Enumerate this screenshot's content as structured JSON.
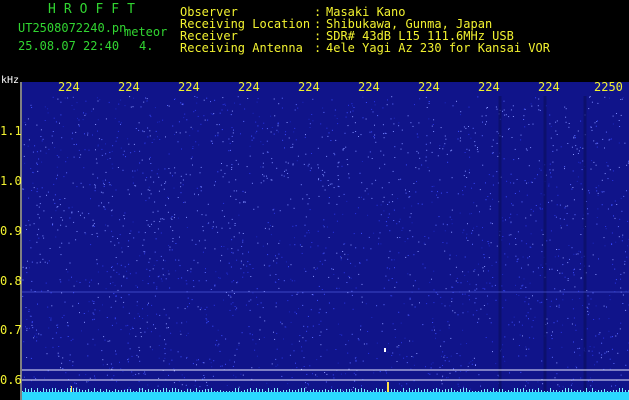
{
  "header": {
    "app_name": "HROFFT",
    "file_name": "UT2508072240.pn",
    "mode": "meteor",
    "date_time": "25.08.07 22:40",
    "counter": "4."
  },
  "info": {
    "observer_label": "Observer",
    "location_label": "Receiving Location",
    "receiver_label": "Receiver",
    "antenna_label": "Receiving Antenna",
    "colon": ":",
    "observer_value": "Masaki Kano",
    "location_value": "Shibukawa, Gunma, Japan",
    "receiver_value": "SDR# 43dB L15 111.6MHz USB",
    "antenna_value": "4ele Yagi Az 230 for Kansai VOR"
  },
  "axis": {
    "unit_label": "kHz",
    "time_ticks": [
      "224",
      "224",
      "224",
      "224",
      "224",
      "224",
      "224",
      "224",
      "224",
      "2250"
    ],
    "freq_ticks": [
      "1.1",
      "1.0",
      "0.9",
      "0.8",
      "0.7",
      "0.6"
    ]
  },
  "colors": {
    "background": "#000000",
    "waterfall_base": "#10148a",
    "noise_dot": "#3a4cff",
    "grid_line": "#ffffff",
    "tick_label": "#f2f230",
    "header_green": "#31d531",
    "signal_strip": "#2ad8ff"
  }
}
